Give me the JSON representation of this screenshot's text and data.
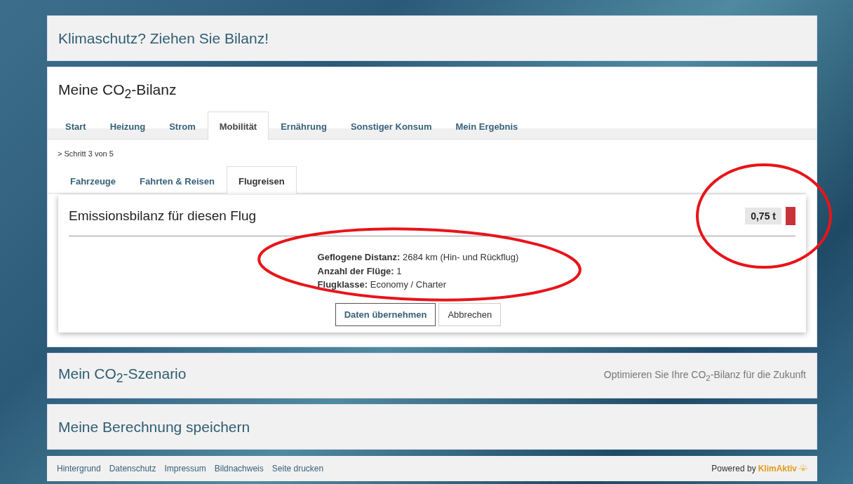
{
  "header": {
    "title": "Klimaschutz? Ziehen Sie Bilanz!"
  },
  "calculator": {
    "title": "Meine CO$_{2}$-Bilanz",
    "tabs": [
      {
        "label": "Start",
        "selected": false
      },
      {
        "label": "Heizung",
        "selected": false
      },
      {
        "label": "Strom",
        "selected": false
      },
      {
        "label": "Mobilität",
        "selected": true
      },
      {
        "label": "Ernährung",
        "selected": false
      },
      {
        "label": "Sonstiger Konsum",
        "selected": false
      },
      {
        "label": "Mein Ergebnis",
        "selected": false
      }
    ],
    "step": "> Schritt 3 von 5",
    "subtabs": [
      {
        "label": "Fahrzeuge",
        "selected": false
      },
      {
        "label": "Fahrten & Reisen",
        "selected": false
      },
      {
        "label": "Flugreisen",
        "selected": true
      }
    ],
    "card": {
      "title": "Emissionsbilanz für diesen Flug",
      "value": "0,75 t",
      "details": [
        {
          "label": "Geflogene Distanz:",
          "value": "2684 km (Hin- und Rückflug)"
        },
        {
          "label": "Anzahl der Flüge:",
          "value": "1"
        },
        {
          "label": "Flugklasse:",
          "value": "Economy / Charter"
        }
      ],
      "buttons": [
        {
          "label": "Daten übernehmen",
          "kind": "primary"
        },
        {
          "label": "Abbrechen",
          "kind": "secondary"
        }
      ]
    }
  },
  "scenario": {
    "title": "Mein CO$_{2}$-Szenario",
    "subtitle": "Optimieren Sie Ihre CO$_{2}$-Bilanz für die Zukunft"
  },
  "save": {
    "title": "Meine Berechnung speichern"
  },
  "footer": {
    "links": [
      "Hintergrund",
      "Datenschutz",
      "Impressum",
      "Bildnachweis",
      "Seite drucken"
    ],
    "powered_by": "Powered by",
    "brand": "KlimAktiv"
  }
}
